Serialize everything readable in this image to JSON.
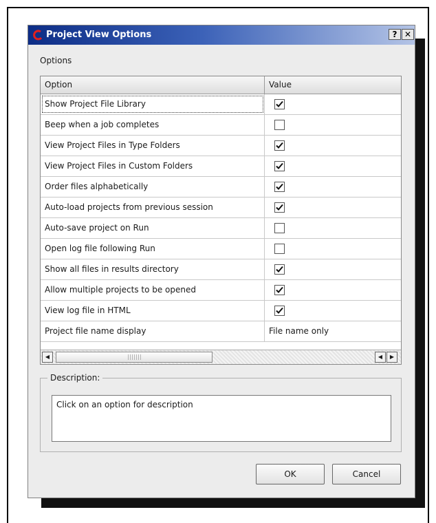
{
  "dialog": {
    "title": "Project View Options",
    "help_button": "?",
    "close_button": "✕"
  },
  "options_label": "Options",
  "grid": {
    "headers": {
      "option": "Option",
      "value": "Value"
    },
    "rows": [
      {
        "label": "Show Project File Library",
        "type": "checkbox",
        "checked": true
      },
      {
        "label": "Beep when a job completes",
        "type": "checkbox",
        "checked": false
      },
      {
        "label": "View Project Files in Type Folders",
        "type": "checkbox",
        "checked": true
      },
      {
        "label": "View Project Files in Custom Folders",
        "type": "checkbox",
        "checked": true
      },
      {
        "label": "Order files alphabetically",
        "type": "checkbox",
        "checked": true
      },
      {
        "label": "Auto-load projects from previous session",
        "type": "checkbox",
        "checked": true
      },
      {
        "label": "Auto-save project on Run",
        "type": "checkbox",
        "checked": false
      },
      {
        "label": "Open log file following Run",
        "type": "checkbox",
        "checked": false
      },
      {
        "label": "Show all files in results directory",
        "type": "checkbox",
        "checked": true
      },
      {
        "label": "Allow multiple projects to be opened",
        "type": "checkbox",
        "checked": true
      },
      {
        "label": "View log file in HTML",
        "type": "checkbox",
        "checked": true
      },
      {
        "label": "Project file name display",
        "type": "text",
        "value": "File name only"
      }
    ]
  },
  "description": {
    "legend": "Description:",
    "text": "Click on an option for description"
  },
  "buttons": {
    "ok": "OK",
    "cancel": "Cancel"
  },
  "colors": {
    "title_start": "#0d2d86",
    "title_end": "#b4c4e6",
    "dialog_bg": "#ececec"
  }
}
